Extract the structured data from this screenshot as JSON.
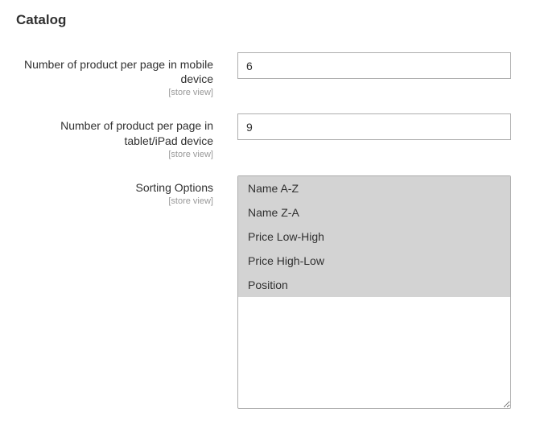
{
  "section": {
    "title": "Catalog"
  },
  "fields": {
    "mobile_per_page": {
      "label": "Number of product per page in mobile device",
      "scope": "[store view]",
      "value": "6"
    },
    "tablet_per_page": {
      "label": "Number of product per page in tablet/iPad device",
      "scope": "[store view]",
      "value": "9"
    },
    "sorting": {
      "label": "Sorting Options",
      "scope": "[store view]",
      "options": [
        "Name A-Z",
        "Name Z-A",
        "Price Low-High",
        "Price High-Low",
        "Position"
      ]
    }
  }
}
